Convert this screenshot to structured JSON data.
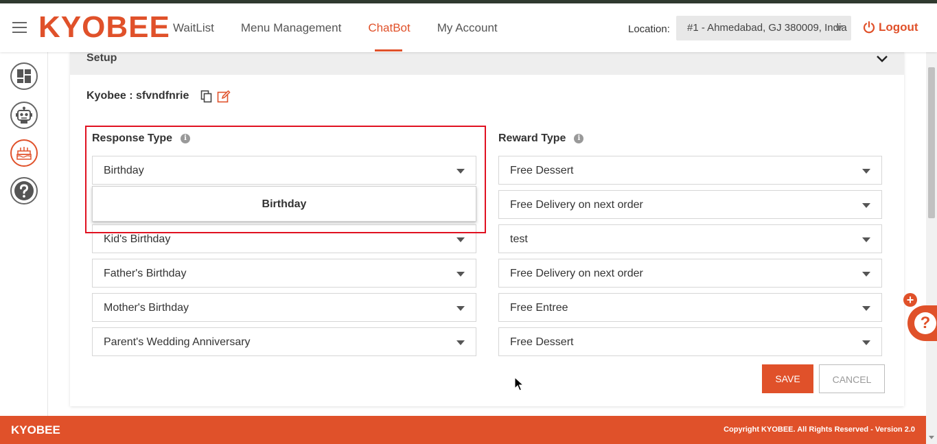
{
  "header": {
    "logo": "KYOBEE",
    "nav": [
      {
        "label": "WaitList",
        "active": false
      },
      {
        "label": "Menu Management",
        "active": false
      },
      {
        "label": "ChatBot",
        "active": true
      },
      {
        "label": "My Account",
        "active": false
      }
    ],
    "location_label": "Location:",
    "location_value": "#1 - Ahmedabad, GJ 380009, India",
    "logout_label": "Logout"
  },
  "sidebar": {
    "items": [
      {
        "icon": "dashboard-icon",
        "active": false
      },
      {
        "icon": "robot-icon",
        "active": false
      },
      {
        "icon": "birthday-cake-icon",
        "active": true
      },
      {
        "icon": "help-icon",
        "active": false
      }
    ]
  },
  "setup": {
    "title": "Setup",
    "bot_name": "Kyobee : sfvndfnrie"
  },
  "form": {
    "response_type_label": "Response Type",
    "reward_type_label": "Reward Type",
    "info_glyph": "i",
    "response_types": [
      "Birthday",
      "",
      "Kid's Birthday",
      "Father's Birthday",
      "Mother's Birthday",
      "Parent's Wedding Anniversary"
    ],
    "reward_types": [
      "Free Dessert",
      "Free Delivery on next order",
      "test",
      "Free Delivery on next order",
      "Free Entree",
      "Free Dessert"
    ],
    "open_dropdown_option": "Birthday"
  },
  "actions": {
    "save_label": "SAVE",
    "cancel_label": "CANCEL"
  },
  "chat_widget": {
    "plus_glyph": "+",
    "bubble_glyph": "?"
  },
  "footer": {
    "brand": "KYOBEE",
    "copyright": "Copyright KYOBEE. All Rights Reserved - Version 2.0"
  },
  "colors": {
    "brand": "#e0512a",
    "highlight_border": "#e01020"
  }
}
